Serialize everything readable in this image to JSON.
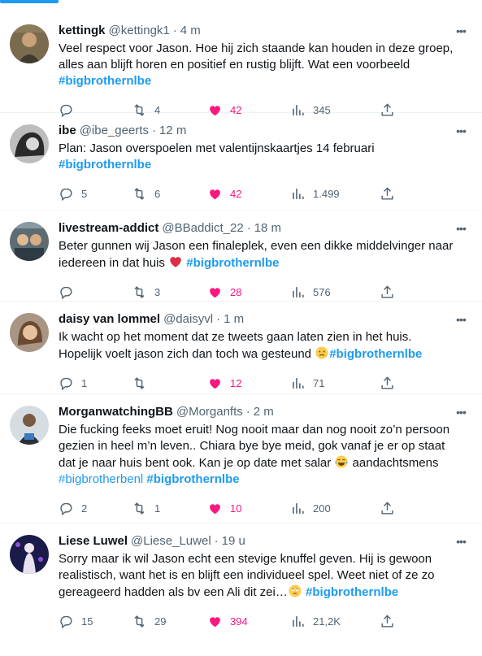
{
  "colors": {
    "accent": "#1d9bf0",
    "like": "#f91880",
    "muted": "#536471",
    "text": "#0f1419",
    "divider": "#eff3f4"
  },
  "icons": {
    "reply": "reply-icon",
    "retweet": "retweet-icon",
    "like": "heart-icon",
    "views": "views-icon",
    "share": "share-icon",
    "more": "more-icon"
  },
  "tweets": [
    {
      "name": "kettingk",
      "handle": "@kettingk1",
      "dot": "·",
      "time": "4 m",
      "text": "Veel respect voor Jason. Hoe hij zich staande kan houden in deze groep, alles aan blijft horen en positief en rustig blijft. Wat een voorbeeld",
      "hashtag1": "#bigbrothernlbe",
      "replies": "",
      "retweets": "4",
      "likes": "42",
      "views": "345"
    },
    {
      "name": "ibe",
      "handle": "@ibe_geerts",
      "dot": "·",
      "time": "12 m",
      "text": "Plan: Jason overspoelen met valentijnskaartjes 14 februari",
      "hashtag1": "#bigbrothernlbe",
      "replies": "5",
      "retweets": "6",
      "likes": "42",
      "views": "1.499"
    },
    {
      "name": "livestream-addict",
      "handle": "@BBaddict_22",
      "dot": "·",
      "time": "18 m",
      "text": "Beter gunnen wij Jason een finaleplek, even een dikke middelvinger naar iedereen in dat huis",
      "hashtag1": "#bigbrothernlbe",
      "replies": "",
      "retweets": "3",
      "likes": "28",
      "views": "576"
    },
    {
      "name": "daisy van lommel",
      "handle": "@daisyvl",
      "dot": "·",
      "time": "1 m",
      "text": "Ik wacht op het moment dat ze tweets gaan laten zien in het huis. Hopelijk voelt jason zich dan toch wa gesteund",
      "hashtag1": "#bigbrothernlbe",
      "replies": "1",
      "retweets": "",
      "likes": "12",
      "views": "71"
    },
    {
      "name": "MorganwatchingBB",
      "handle": "@Morganfts",
      "dot": "·",
      "time": "2 m",
      "text": "Die fucking feeks moet eruit! Nog nooit maar dan nog nooit zo’n persoon gezien in heel m’n leven.. Chiara bye bye meid, gok vanaf je er op staat dat je naar huis bent ook. Kan je op date met salar",
      "text_tail": " aandachtsmens",
      "hashtag0": "#bigbrotherbenl",
      "hashtag1": "#bigbrothernlbe",
      "replies": "2",
      "retweets": "1",
      "likes": "10",
      "views": "200"
    },
    {
      "name": "Liese Luwel",
      "handle": "@Liese_Luwel",
      "dot": "·",
      "time": "19 u",
      "text": "Sorry maar ik wil Jason echt een stevige knuffel geven. Hij is gewoon realistisch, want het is en blijft een individueel spel. Weet niet of ze zo gereageerd hadden als bv een Ali dit zei…",
      "hashtag1": "#bigbrothernlbe",
      "replies": "15",
      "retweets": "29",
      "likes": "394",
      "views": "21,2K"
    }
  ]
}
